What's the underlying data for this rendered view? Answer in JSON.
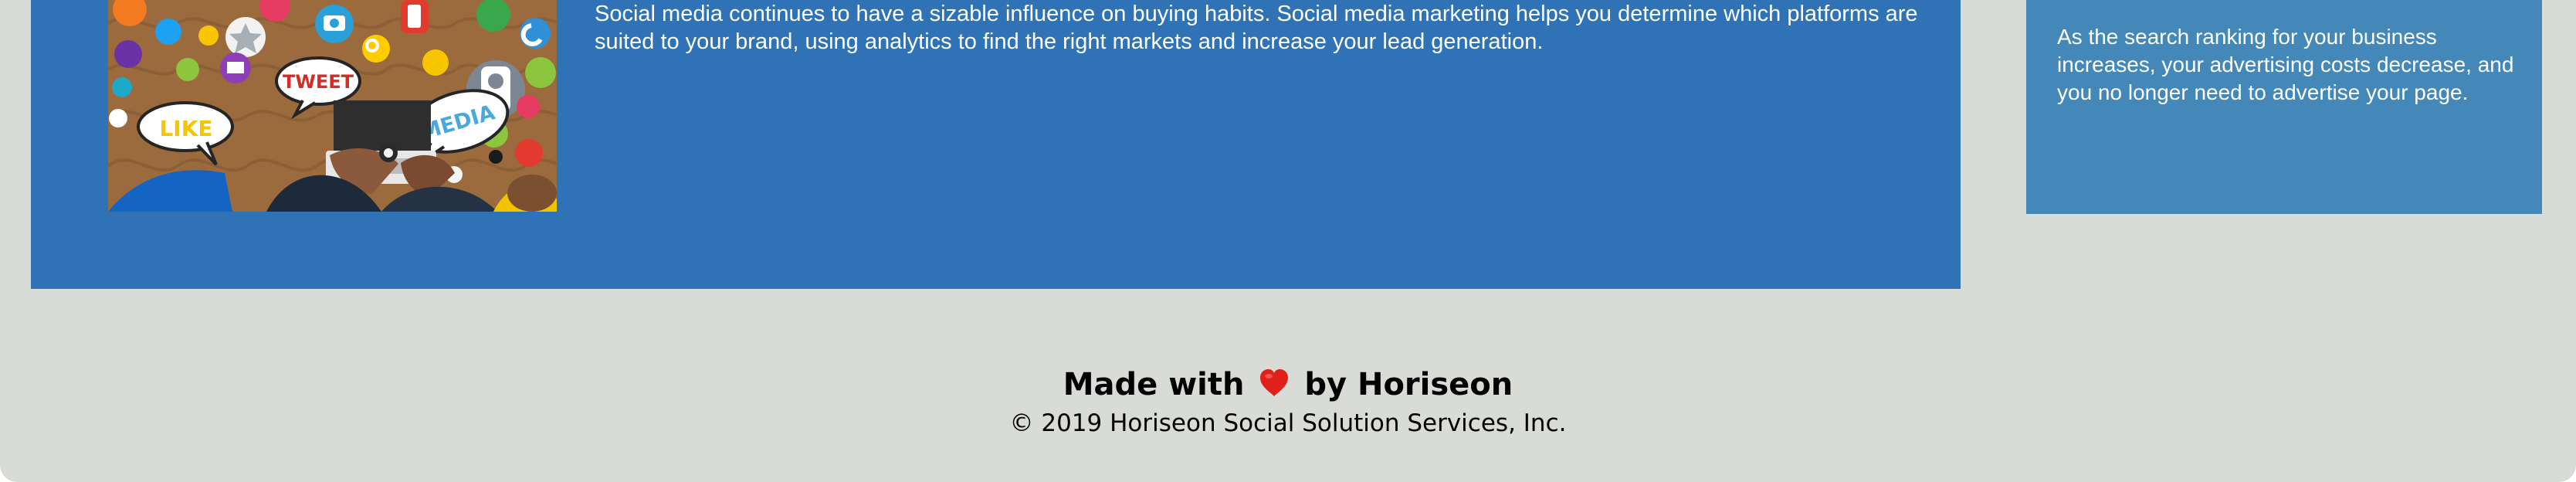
{
  "article": {
    "body": "Social media continues to have a sizable influence on buying habits. Social media marketing helps you determine which platforms are suited to your brand, using analytics to find the right markets and increase your lead generation.",
    "image": {
      "label_tweet": "TWEET",
      "label_like": "LIKE",
      "label_media": "MEDIA",
      "primary_color": "#9a6a3f"
    }
  },
  "benefit": {
    "body": "As the search ranking for your business increases, your advertising costs decrease, and you no longer need to advertise your page."
  },
  "footer": {
    "credit_prefix": "Made with",
    "credit_suffix": "by Horiseon",
    "heart_icon": "heart-icon",
    "copyright": "© 2019 Horiseon Social Solution Services, Inc."
  },
  "colors": {
    "page_background": "#d9dcd6",
    "main_panel": "#2f73b6",
    "benefit_card": "#4488b9",
    "text_light": "#ffffff",
    "heart": "#e0201b"
  }
}
